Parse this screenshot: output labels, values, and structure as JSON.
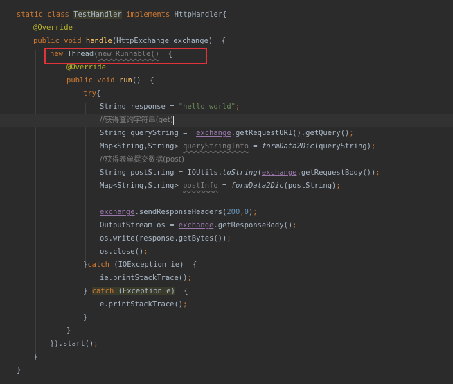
{
  "code": {
    "l1": {
      "a": "static",
      "b": "class",
      "c": "TestHandler",
      "d": "implements",
      "e": "HttpHandler{"
    },
    "l2": {
      "a": "@Override"
    },
    "l3": {
      "a": "public",
      "b": "void",
      "c": "handle",
      "d": "(HttpExchange exchange)  {"
    },
    "l4": {
      "a": "new",
      "b": "Thread(",
      "c": "new Runnable()",
      "d": "{"
    },
    "l5": {
      "a": "@Override"
    },
    "l6": {
      "a": "public",
      "b": "void",
      "c": "run",
      "d": "()  {"
    },
    "l7": {
      "a": "try",
      "b": "{"
    },
    "l8": {
      "a": "String response = ",
      "b": "\"hello world\"",
      "c": ";"
    },
    "l9": {
      "a": "//获得查询字符串(get)"
    },
    "l10": {
      "a": "String queryString =  ",
      "b": "exchange",
      "c": ".getRequestURI().getQuery()",
      "d": ";"
    },
    "l11": {
      "a": "Map<String,String> ",
      "b": "queryStringInfo",
      "c": " = ",
      "d": "formData2Dic",
      "e": "(queryString)",
      "f": ";"
    },
    "l12": {
      "a": "//获得表单提交数据(post)"
    },
    "l13": {
      "a": "String postString = IOUtils.",
      "b": "toString",
      "c": "(",
      "d": "exchange",
      "e": ".getRequestBody())",
      "f": ";"
    },
    "l14": {
      "a": "Map<String,String> ",
      "b": "postInfo",
      "c": " = ",
      "d": "formData2Dic",
      "e": "(postString)",
      "f": ";"
    },
    "l16": {
      "a": "exchange",
      "b": ".sendResponseHeaders(",
      "c": "200",
      "d": ",",
      "e": "0",
      "f": ")",
      "g": ";"
    },
    "l17": {
      "a": "OutputStream os = ",
      "b": "exchange",
      "c": ".getResponseBody()",
      "d": ";"
    },
    "l18": {
      "a": "os.write(response.getBytes())",
      "b": ";"
    },
    "l19": {
      "a": "os.close()",
      "b": ";"
    },
    "l20": {
      "a": "}",
      "b": "catch",
      "c": " (IOException ie)  {"
    },
    "l21": {
      "a": "ie.printStackTrace()",
      "b": ";"
    },
    "l22": {
      "a": "}",
      "b": "catch",
      "c": " (Exception e)",
      "d": "  {"
    },
    "l23": {
      "a": "e.printStackTrace()",
      "b": ";"
    },
    "l24": {
      "a": "}"
    },
    "l25": {
      "a": "}"
    },
    "l26": {
      "a": "}).start()",
      "b": ";"
    },
    "l27": {
      "a": "}"
    },
    "l28": {
      "a": "}"
    }
  },
  "colors": {
    "background": "#2b2b2b",
    "keyword": "#cc7832",
    "annotation": "#bbb529",
    "method": "#ffc66d",
    "string": "#6a8759",
    "number": "#6897bb",
    "comment": "#808080",
    "field": "#9876aa",
    "highlight_box": "#e0343a"
  }
}
